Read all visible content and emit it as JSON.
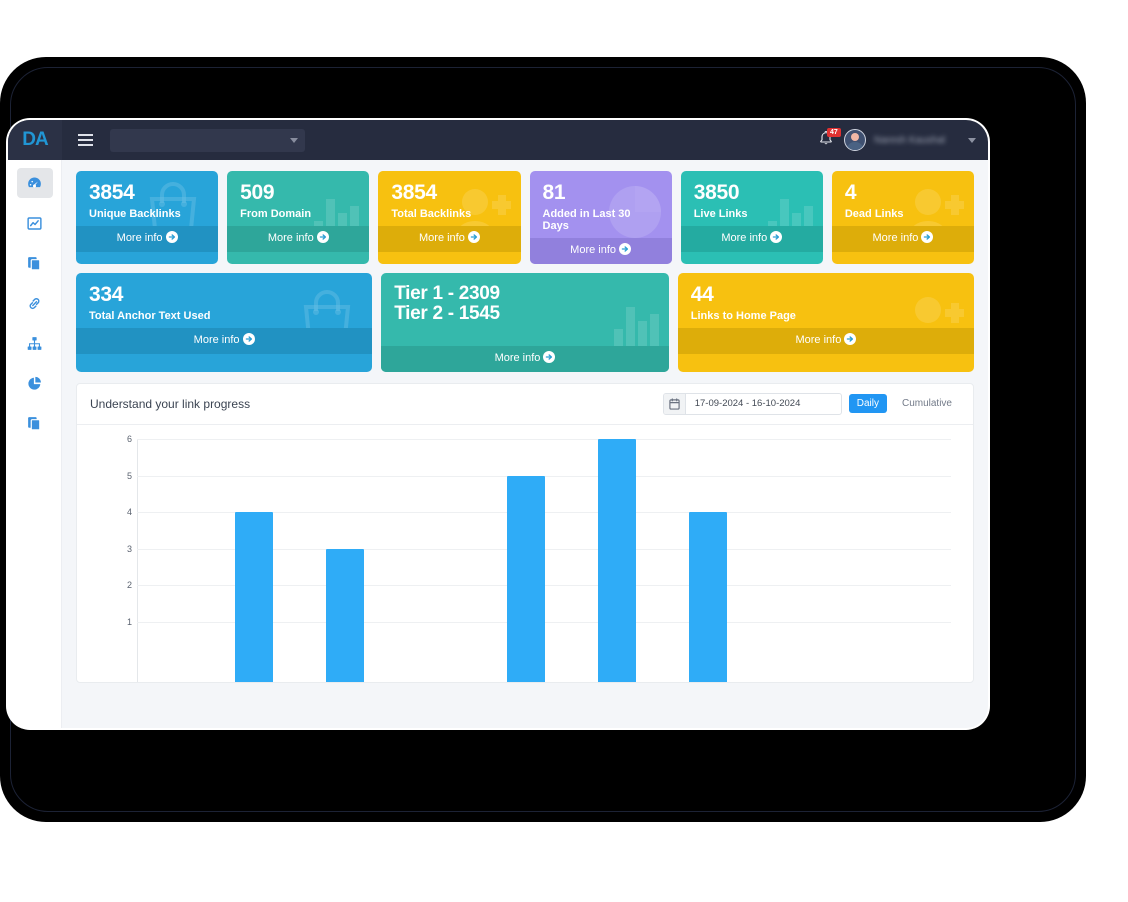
{
  "brand": {
    "logo_text": "DA"
  },
  "topbar": {
    "menu_toggle": "menu-icon",
    "select_value": "",
    "select_placeholder": "",
    "notification_count": "47",
    "username": "Naresh Kaushal"
  },
  "sidebar": {
    "items": [
      {
        "name": "dashboard",
        "icon": "speedometer-icon",
        "active": true
      },
      {
        "name": "reports",
        "icon": "chart-line-icon",
        "active": false
      },
      {
        "name": "documents",
        "icon": "copy-files-icon",
        "active": false
      },
      {
        "name": "links",
        "icon": "link-icon",
        "active": false
      },
      {
        "name": "sitemap",
        "icon": "sitemap-icon",
        "active": false
      },
      {
        "name": "analytics",
        "icon": "pie-chart-icon",
        "active": false
      },
      {
        "name": "archive",
        "icon": "copy-files-icon",
        "active": false
      }
    ]
  },
  "cards_row1": [
    {
      "value": "3854",
      "label": "Unique Backlinks",
      "more_info": "More info",
      "color": "#28a4d9",
      "foot_color": "#2192c2",
      "icon": "shopping-bag-icon"
    },
    {
      "value": "509",
      "label": "From Domain",
      "more_info": "More info",
      "color": "#35b9ac",
      "foot_color": "#2ea69a",
      "icon": "bar-chart-icon"
    },
    {
      "value": "3854",
      "label": "Total Backlinks",
      "more_info": "More info",
      "color": "#f7c110",
      "foot_color": "#ddad0a",
      "icon": "user-plus-icon"
    },
    {
      "value": "81",
      "label": "Added in Last 30 Days",
      "more_info": "More info",
      "color": "#a391ef",
      "foot_color": "#9180dd",
      "icon": "pie-chart-icon"
    },
    {
      "value": "3850",
      "label": "Live Links",
      "more_info": "More info",
      "color": "#2bbfb4",
      "foot_color": "#24aba1",
      "icon": "bar-chart-icon"
    },
    {
      "value": "4",
      "label": "Dead Links",
      "more_info": "More info",
      "color": "#f7c110",
      "foot_color": "#ddad0a",
      "icon": "user-plus-icon"
    }
  ],
  "cards_row2": [
    {
      "value": "334",
      "value2": "",
      "label": "Total Anchor Text Used",
      "more_info": "More info",
      "color": "#28a4d9",
      "foot_color": "#2192c2",
      "icon": "shopping-bag-icon"
    },
    {
      "value": "Tier 1 - 2309",
      "value2": "Tier 2 - 1545",
      "label": "",
      "more_info": "More info",
      "color": "#35b9ac",
      "foot_color": "#2ea69a",
      "icon": "bar-chart-icon"
    },
    {
      "value": "44",
      "value2": "",
      "label": "Links to Home Page",
      "more_info": "More info",
      "color": "#f7c110",
      "foot_color": "#ddad0a",
      "icon": "user-plus-icon"
    }
  ],
  "chart_panel": {
    "title": "Understand your link progress",
    "calendar_icon": "calendar-icon",
    "date_range": "17-09-2024 - 16-10-2024",
    "toggle_daily": "Daily",
    "toggle_cumulative": "Cumulative",
    "active_toggle": "Daily"
  },
  "chart_data": {
    "type": "bar",
    "title": "Understand your link progress",
    "xlabel": "",
    "ylabel": "",
    "ylim": [
      0,
      6
    ],
    "yticks": [
      1,
      2,
      3,
      4,
      5,
      6
    ],
    "grid": true,
    "legend": "none",
    "bar_color": "#2facf7",
    "categories": [
      "",
      "",
      "",
      "",
      "",
      "",
      "",
      "",
      "",
      "",
      "",
      "",
      "",
      "",
      "",
      "",
      "",
      "",
      "",
      ""
    ],
    "values": [
      0,
      0,
      4,
      0,
      3,
      0,
      0,
      0,
      5,
      0,
      6,
      0,
      4,
      0,
      0,
      0,
      0,
      0,
      0,
      0
    ],
    "visible_bars": [
      {
        "index": 2,
        "value": 4
      },
      {
        "index": 4,
        "value": 3
      },
      {
        "index": 8,
        "value": 5
      },
      {
        "index": 10,
        "value": 6
      },
      {
        "index": 12,
        "value": 4
      }
    ],
    "note": "Chart is vertically cropped by the device viewport; x-axis tick labels are not visible."
  }
}
